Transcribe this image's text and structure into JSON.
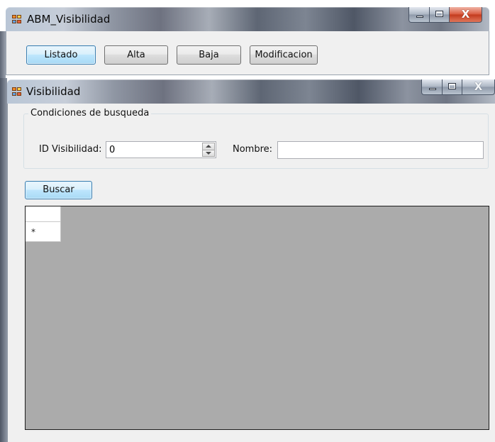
{
  "main_window": {
    "title": "ABM_Visibilidad",
    "toolbar": {
      "listado_label": "Listado",
      "alta_label": "Alta",
      "baja_label": "Baja",
      "modificacion_label": "Modificacion"
    },
    "close_glyph": "X"
  },
  "child_window": {
    "title": "Visibilidad",
    "close_glyph": "X",
    "search_group": {
      "legend": "Condiciones de busqueda",
      "id_label": "ID Visibilidad:",
      "id_value": "0",
      "name_label": "Nombre:",
      "name_value": ""
    },
    "search_button_label": "Buscar",
    "grid": {
      "new_row_marker": "*"
    }
  },
  "colors": {
    "window_bg": "#f0f0f0",
    "grid_bg": "#ababab",
    "focus_border": "#3c7fb1"
  },
  "icons": [
    "app-icon",
    "minimize-icon",
    "maximize-icon",
    "close-icon",
    "spinner-up-icon",
    "spinner-down-icon"
  ]
}
